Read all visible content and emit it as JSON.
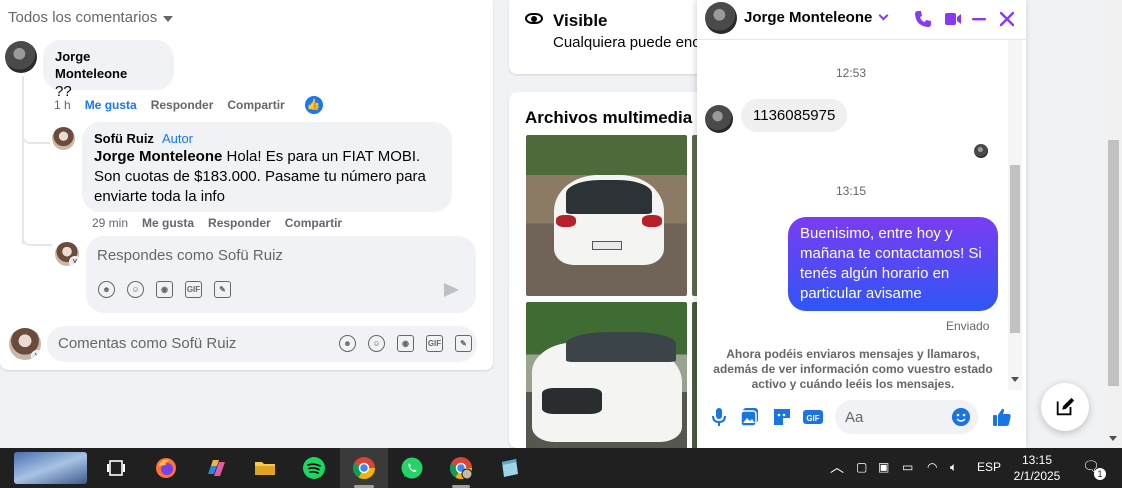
{
  "comments": {
    "filter_label": "Todos los comentarios",
    "items": [
      {
        "author": "Jorge Monteleone",
        "text": "??",
        "time": "1 h",
        "actions": [
          "Me gusta",
          "Responder",
          "Compartir"
        ],
        "liked": true
      },
      {
        "author": "Sofü Ruiz",
        "author_tag": "Autor",
        "mention": "Jorge Monteleone",
        "text": "Hola! Es para un FIAT MOBI. Son cuotas de $183.000. Pasame tu número para enviarte toda la info",
        "time": "29 min",
        "actions": [
          "Me gusta",
          "Responder",
          "Compartir"
        ]
      }
    ],
    "reply_placeholder": "Respondes como Sofü Ruiz",
    "comment_placeholder": "Comentas como Sofü Ruiz",
    "toolbar_icons": [
      "avatar-sticker-icon",
      "emoji-icon",
      "camera-icon",
      "gif-icon",
      "sticker-icon"
    ]
  },
  "visibility": {
    "title": "Visible",
    "subtitle": "Cualquiera puede enc"
  },
  "media": {
    "title": "Archivos multimedia re"
  },
  "chat": {
    "contact_name": "Jorge Monteleone",
    "accent_color": "#8a38f5",
    "messages": [
      {
        "type": "timestamp",
        "text": "12:53"
      },
      {
        "type": "incoming",
        "text": "1136085975"
      },
      {
        "type": "timestamp",
        "text": "13:15"
      },
      {
        "type": "outgoing",
        "text": "Buenisimo, entre hoy y mañana te contactamos! Si tenés algún horario en particular avisame"
      }
    ],
    "status": "Enviado",
    "notice": "Ahora podéis enviaros mensajes y llamaros, además de ver información como vuestro estado activo y cuándo leéis los mensajes.",
    "input_placeholder": "Aa"
  },
  "taskbar": {
    "apps": [
      "task-view-icon",
      "firefox-icon",
      "copilot-icon",
      "file-explorer-icon",
      "spotify-icon",
      "chrome-icon",
      "whatsapp-icon",
      "chrome-profile-icon",
      "notes-icon"
    ],
    "language": "ESP",
    "time": "13:15",
    "date": "2/1/2025",
    "notification_count": "1"
  }
}
